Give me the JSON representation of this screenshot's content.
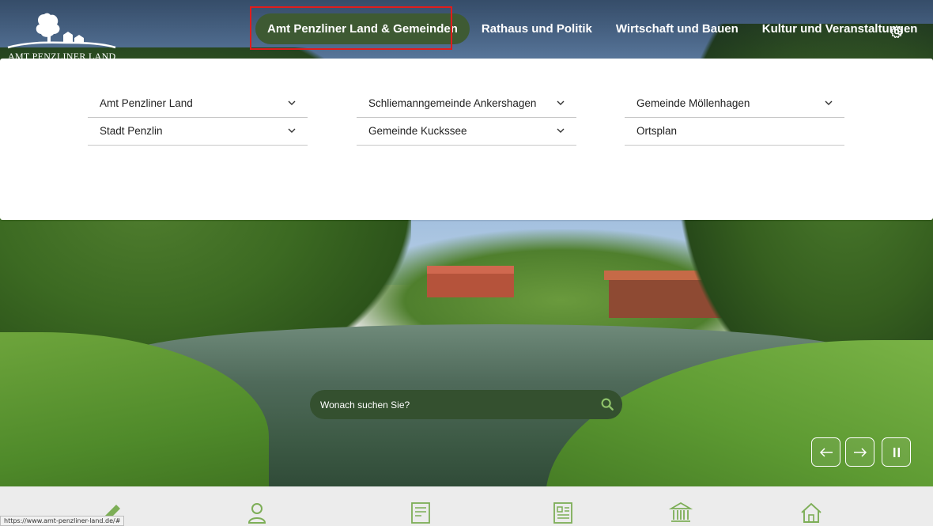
{
  "header": {
    "logo_text": "AMT PENZLINER LAND",
    "nav": [
      {
        "label": "Amt Penzliner Land & Gemeinden",
        "active": true
      },
      {
        "label": "Rathaus und Politik"
      },
      {
        "label": "Wirtschaft und Bauen"
      },
      {
        "label": "Kultur und Veranstaltungen"
      }
    ],
    "settings_icon": "gear-icon"
  },
  "dropdown": {
    "columns": [
      [
        {
          "label": "Amt Penzliner Land",
          "expandable": true
        },
        {
          "label": "Stadt Penzlin",
          "expandable": true
        }
      ],
      [
        {
          "label": "Schliemanngemeinde Ankershagen",
          "expandable": true
        },
        {
          "label": "Gemeinde Kuckssee",
          "expandable": true
        }
      ],
      [
        {
          "label": "Gemeinde Möllenhagen",
          "expandable": true
        },
        {
          "label": "Ortsplan",
          "expandable": false
        }
      ]
    ]
  },
  "search": {
    "placeholder": "Wonach suchen Sie?",
    "icon": "search-icon"
  },
  "slider_controls": [
    "arrow-left-icon",
    "arrow-right-icon",
    "pause-icon"
  ],
  "quick_links": [
    "pencil-icon",
    "person-icon",
    "form-document-icon",
    "newspaper-icon",
    "town-hall-icon",
    "house-icon"
  ],
  "status_url": "https://www.amt-penzliner-land.de/#",
  "colors": {
    "accent_green": "#3e5a33",
    "icon_green": "#7dae57",
    "highlight_red": "#e11c1c"
  }
}
